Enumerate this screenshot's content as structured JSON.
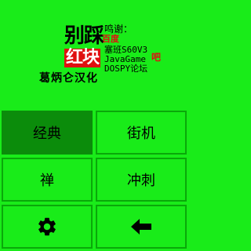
{
  "title_line1": "别踩",
  "title_line2": "红块",
  "thanks_label": "鸣谢：",
  "baidu_label": "百度",
  "credits": [
    "塞班S60V3",
    "JavaGame",
    "DOSPY论坛"
  ],
  "credit_suffix": "吧",
  "translator": "葛炳仑汉化",
  "menu": {
    "classic": "经典",
    "arcade": "街机",
    "zen": "禅",
    "rush": "冲刺"
  },
  "colors": {
    "background": "#19ec19",
    "selected": "#0b8c0b",
    "accent": "#e01010"
  },
  "icons": {
    "settings": "gear-icon",
    "back": "arrow-left-icon"
  }
}
